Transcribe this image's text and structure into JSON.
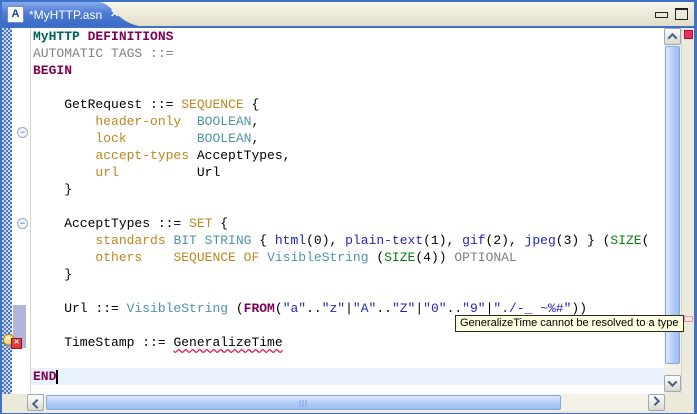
{
  "tab": {
    "label": "*MyHTTP.asn",
    "icon_letter": "A"
  },
  "icons": {
    "close": "✕",
    "fold_collapsed": "−",
    "error_x": "✕"
  },
  "tooltip": {
    "text": "GeneralizeTime cannot be resolved to a type"
  },
  "colors": {
    "frame": "#3d72c8",
    "strip_bg": "#ece9d8",
    "tab_bottom": "#3a68c4",
    "checker_a": "#4a76bd",
    "checker_b": "#ccd8ee",
    "current_line": "#e9f1fc",
    "range_indicator": "#b3b4db",
    "tooltip_bg": "#ffffe1",
    "error_marker": "#e8315a",
    "syntax": {
      "plain": "#000000",
      "module": "#00605f",
      "kw": "#7f0055",
      "gray": "#808080",
      "gold": "#bf861b",
      "teal": "#4f94a4",
      "blue": "#2424bb",
      "green": "#0c7a0c",
      "err": "#000000"
    }
  },
  "code": {
    "lines": [
      [
        [
          "module",
          "MyHTTP"
        ],
        [
          "plain",
          " "
        ],
        [
          "kw",
          "DEFINITIONS"
        ]
      ],
      [
        [
          "gray",
          "AUTOMATIC TAGS ::="
        ]
      ],
      [
        [
          "kw",
          "BEGIN"
        ]
      ],
      [],
      [
        [
          "plain",
          "    GetRequest ::= "
        ],
        [
          "gold",
          "SEQUENCE"
        ],
        [
          "plain",
          " {"
        ]
      ],
      [
        [
          "plain",
          "        "
        ],
        [
          "gold",
          "header-only"
        ],
        [
          "plain",
          "  "
        ],
        [
          "teal",
          "BOOLEAN"
        ],
        [
          "plain",
          ","
        ]
      ],
      [
        [
          "plain",
          "        "
        ],
        [
          "gold",
          "lock"
        ],
        [
          "plain",
          "         "
        ],
        [
          "teal",
          "BOOLEAN"
        ],
        [
          "plain",
          ","
        ]
      ],
      [
        [
          "plain",
          "        "
        ],
        [
          "gold",
          "accept-types"
        ],
        [
          "plain",
          " AcceptTypes,"
        ]
      ],
      [
        [
          "plain",
          "        "
        ],
        [
          "gold",
          "url"
        ],
        [
          "plain",
          "          Url"
        ]
      ],
      [
        [
          "plain",
          "    }"
        ]
      ],
      [],
      [
        [
          "plain",
          "    AcceptTypes ::= "
        ],
        [
          "gold",
          "SET"
        ],
        [
          "plain",
          " {"
        ]
      ],
      [
        [
          "plain",
          "        "
        ],
        [
          "gold",
          "standards"
        ],
        [
          "plain",
          " "
        ],
        [
          "teal",
          "BIT STRING"
        ],
        [
          "plain",
          " { "
        ],
        [
          "blue",
          "html"
        ],
        [
          "plain",
          "(0), "
        ],
        [
          "blue",
          "plain-text"
        ],
        [
          "plain",
          "(1), "
        ],
        [
          "blue",
          "gif"
        ],
        [
          "plain",
          "(2), "
        ],
        [
          "blue",
          "jpeg"
        ],
        [
          "plain",
          "(3) } ("
        ],
        [
          "green",
          "SIZE"
        ],
        [
          "plain",
          "("
        ]
      ],
      [
        [
          "plain",
          "        "
        ],
        [
          "gold",
          "others"
        ],
        [
          "plain",
          "    "
        ],
        [
          "gold",
          "SEQUENCE OF"
        ],
        [
          "plain",
          " "
        ],
        [
          "teal",
          "VisibleString"
        ],
        [
          "plain",
          " ("
        ],
        [
          "green",
          "SIZE"
        ],
        [
          "plain",
          "(4)) "
        ],
        [
          "gray",
          "OPTIONAL"
        ]
      ],
      [
        [
          "plain",
          "    }"
        ]
      ],
      [],
      [
        [
          "plain",
          "    Url ::= "
        ],
        [
          "teal",
          "VisibleString"
        ],
        [
          "plain",
          " ("
        ],
        [
          "kw",
          "FROM"
        ],
        [
          "plain",
          "("
        ],
        [
          "blue",
          "\"a\""
        ],
        [
          "plain",
          ".."
        ],
        [
          "blue",
          "\"z\""
        ],
        [
          "plain",
          "|"
        ],
        [
          "blue",
          "\"A\""
        ],
        [
          "plain",
          ".."
        ],
        [
          "blue",
          "\"Z\""
        ],
        [
          "plain",
          "|"
        ],
        [
          "blue",
          "\"0\""
        ],
        [
          "plain",
          ".."
        ],
        [
          "blue",
          "\"9\""
        ],
        [
          "plain",
          "|"
        ],
        [
          "blue",
          "\"./-_ ~%#\""
        ],
        [
          "plain",
          "))"
        ]
      ],
      [],
      [
        [
          "plain",
          "    TimeStamp ::= "
        ],
        [
          "err",
          "GeneralizeTime"
        ]
      ],
      [],
      [
        [
          "kw",
          "END"
        ]
      ]
    ]
  }
}
